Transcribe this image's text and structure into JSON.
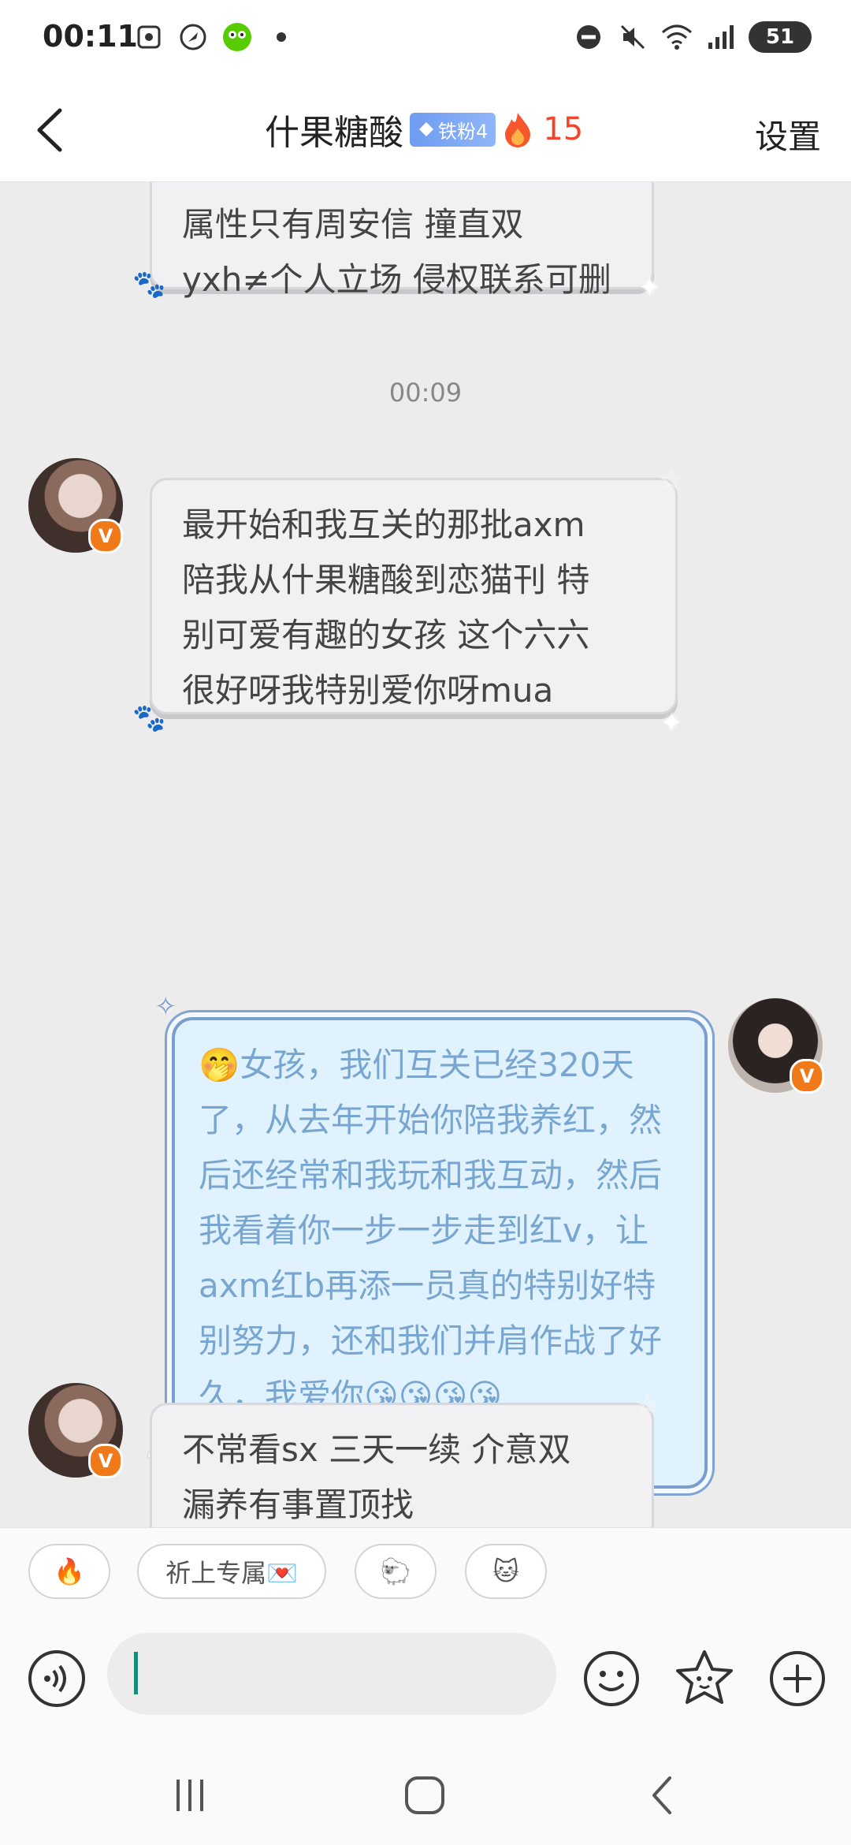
{
  "status_bar": {
    "time": "00:11",
    "battery": "51",
    "left_icons": [
      "screenshot-icon",
      "rocket-icon",
      "duolingo-icon",
      "dot-icon"
    ],
    "right_icons": [
      "dnd-icon",
      "mute-icon",
      "wifi-icon",
      "signal-icon"
    ]
  },
  "header": {
    "back_icon": "chevron-left-icon",
    "title": "什果糖酸",
    "fan_badge": "铁粉4",
    "fire_count": "15",
    "settings_label": "设置"
  },
  "messages": [
    {
      "side": "left",
      "text": "属性只有周安信 撞直双\nyxh≠个人立场 侵权联系可删",
      "partial": true
    },
    {
      "type": "time",
      "text": "00:09"
    },
    {
      "side": "left",
      "text": "最开始和我互关的那批axm\n陪我从什果糖酸到恋猫刊 特\n别可爱有趣的女孩 这个六六\n很好呀我特别爱你呀mua"
    },
    {
      "side": "right",
      "text": "🤭女孩，我们互关已经320天了，从去年开始你陪我养红，然后还经常和我玩和我互动，然后我看着你一步一步走到红v，让axm红b再添一员真的特别好特别努力，还和我们并肩作战了好久，我爱你😘😘😘😘"
    },
    {
      "side": "left",
      "text": "不常看sx 三天一续 介意双\n漏养有事置顶找",
      "partial": true
    }
  ],
  "quick_replies": [
    "🔥",
    "祈上专属💌",
    "🐑",
    "🐱"
  ],
  "input": {
    "value": "",
    "placeholder": "",
    "voice_icon": "voice-icon",
    "emoji_icon": "emoji-icon",
    "sticker_icon": "sticker-icon",
    "plus_icon": "plus-icon"
  },
  "nav": [
    "recents-icon",
    "home-icon",
    "back-icon"
  ],
  "colors": {
    "accent_fire": "#f2452d",
    "verified_badge": "#f07a1a",
    "my_bubble_bg": "#dff2fd",
    "my_bubble_text": "#79a6d1"
  }
}
